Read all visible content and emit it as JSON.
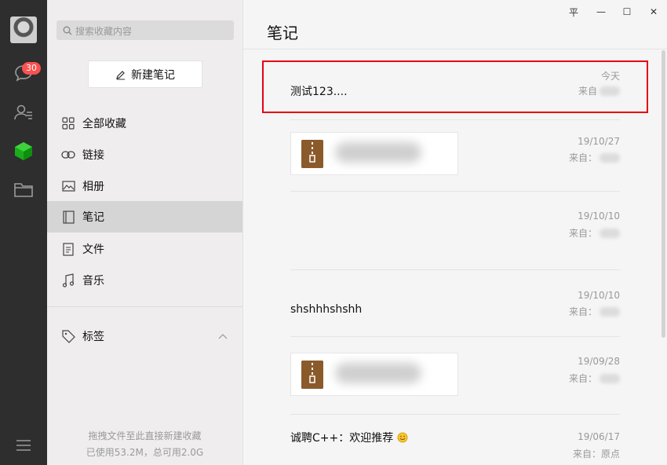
{
  "iconbar": {
    "badge_count": "30"
  },
  "sidebar": {
    "search_placeholder": "搜索收藏内容",
    "new_note_label": "新建笔记",
    "nav": [
      {
        "label": "全部收藏",
        "icon": "grid-icon"
      },
      {
        "label": "链接",
        "icon": "link-icon"
      },
      {
        "label": "相册",
        "icon": "image-icon"
      },
      {
        "label": "笔记",
        "icon": "note-icon"
      },
      {
        "label": "文件",
        "icon": "file-icon"
      },
      {
        "label": "音乐",
        "icon": "music-icon"
      }
    ],
    "tags_label": "标签",
    "footer_line1": "拖拽文件至此直接新建收藏",
    "footer_line2": "已使用53.2M，总可用2.0G"
  },
  "main": {
    "title": "笔记",
    "window": {
      "pin": "平",
      "minimize": "—",
      "maximize": "☐",
      "close": "✕"
    },
    "items": [
      {
        "date": "今天",
        "source_label": "来自",
        "text": "测试123...."
      },
      {
        "date": "19/10/27",
        "source_label": "来自：",
        "text": ""
      },
      {
        "date": "19/10/10",
        "source_label": "来自：",
        "text": ""
      },
      {
        "date": "19/10/10",
        "source_label": "来自：",
        "text": "shshhhshshh"
      },
      {
        "date": "19/09/28",
        "source_label": "来自：",
        "text": ""
      },
      {
        "date": "19/06/17",
        "source_label": "来自：原点",
        "text": "诚聘C++：欢迎推荐"
      }
    ]
  },
  "colors": {
    "accent": "#07c160",
    "badge": "#fa5151",
    "highlight": "#e60012"
  }
}
